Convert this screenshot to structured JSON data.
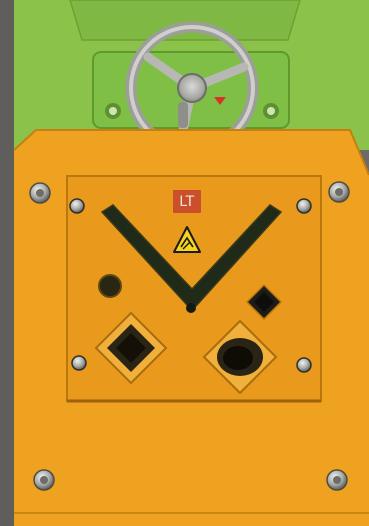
{
  "image": {
    "brand_plate_text": "LT",
    "icons": [
      "handwheel-icon",
      "hand-crush-warning-icon"
    ],
    "colors": {
      "machine_green": "#8bc34a",
      "guard_orange": "#efa21f",
      "plate_orange": "#e99a1c",
      "slot_dark": "#1f2a18",
      "brand_plate": "#c9502b",
      "background_gray": "#6b6a66"
    }
  }
}
